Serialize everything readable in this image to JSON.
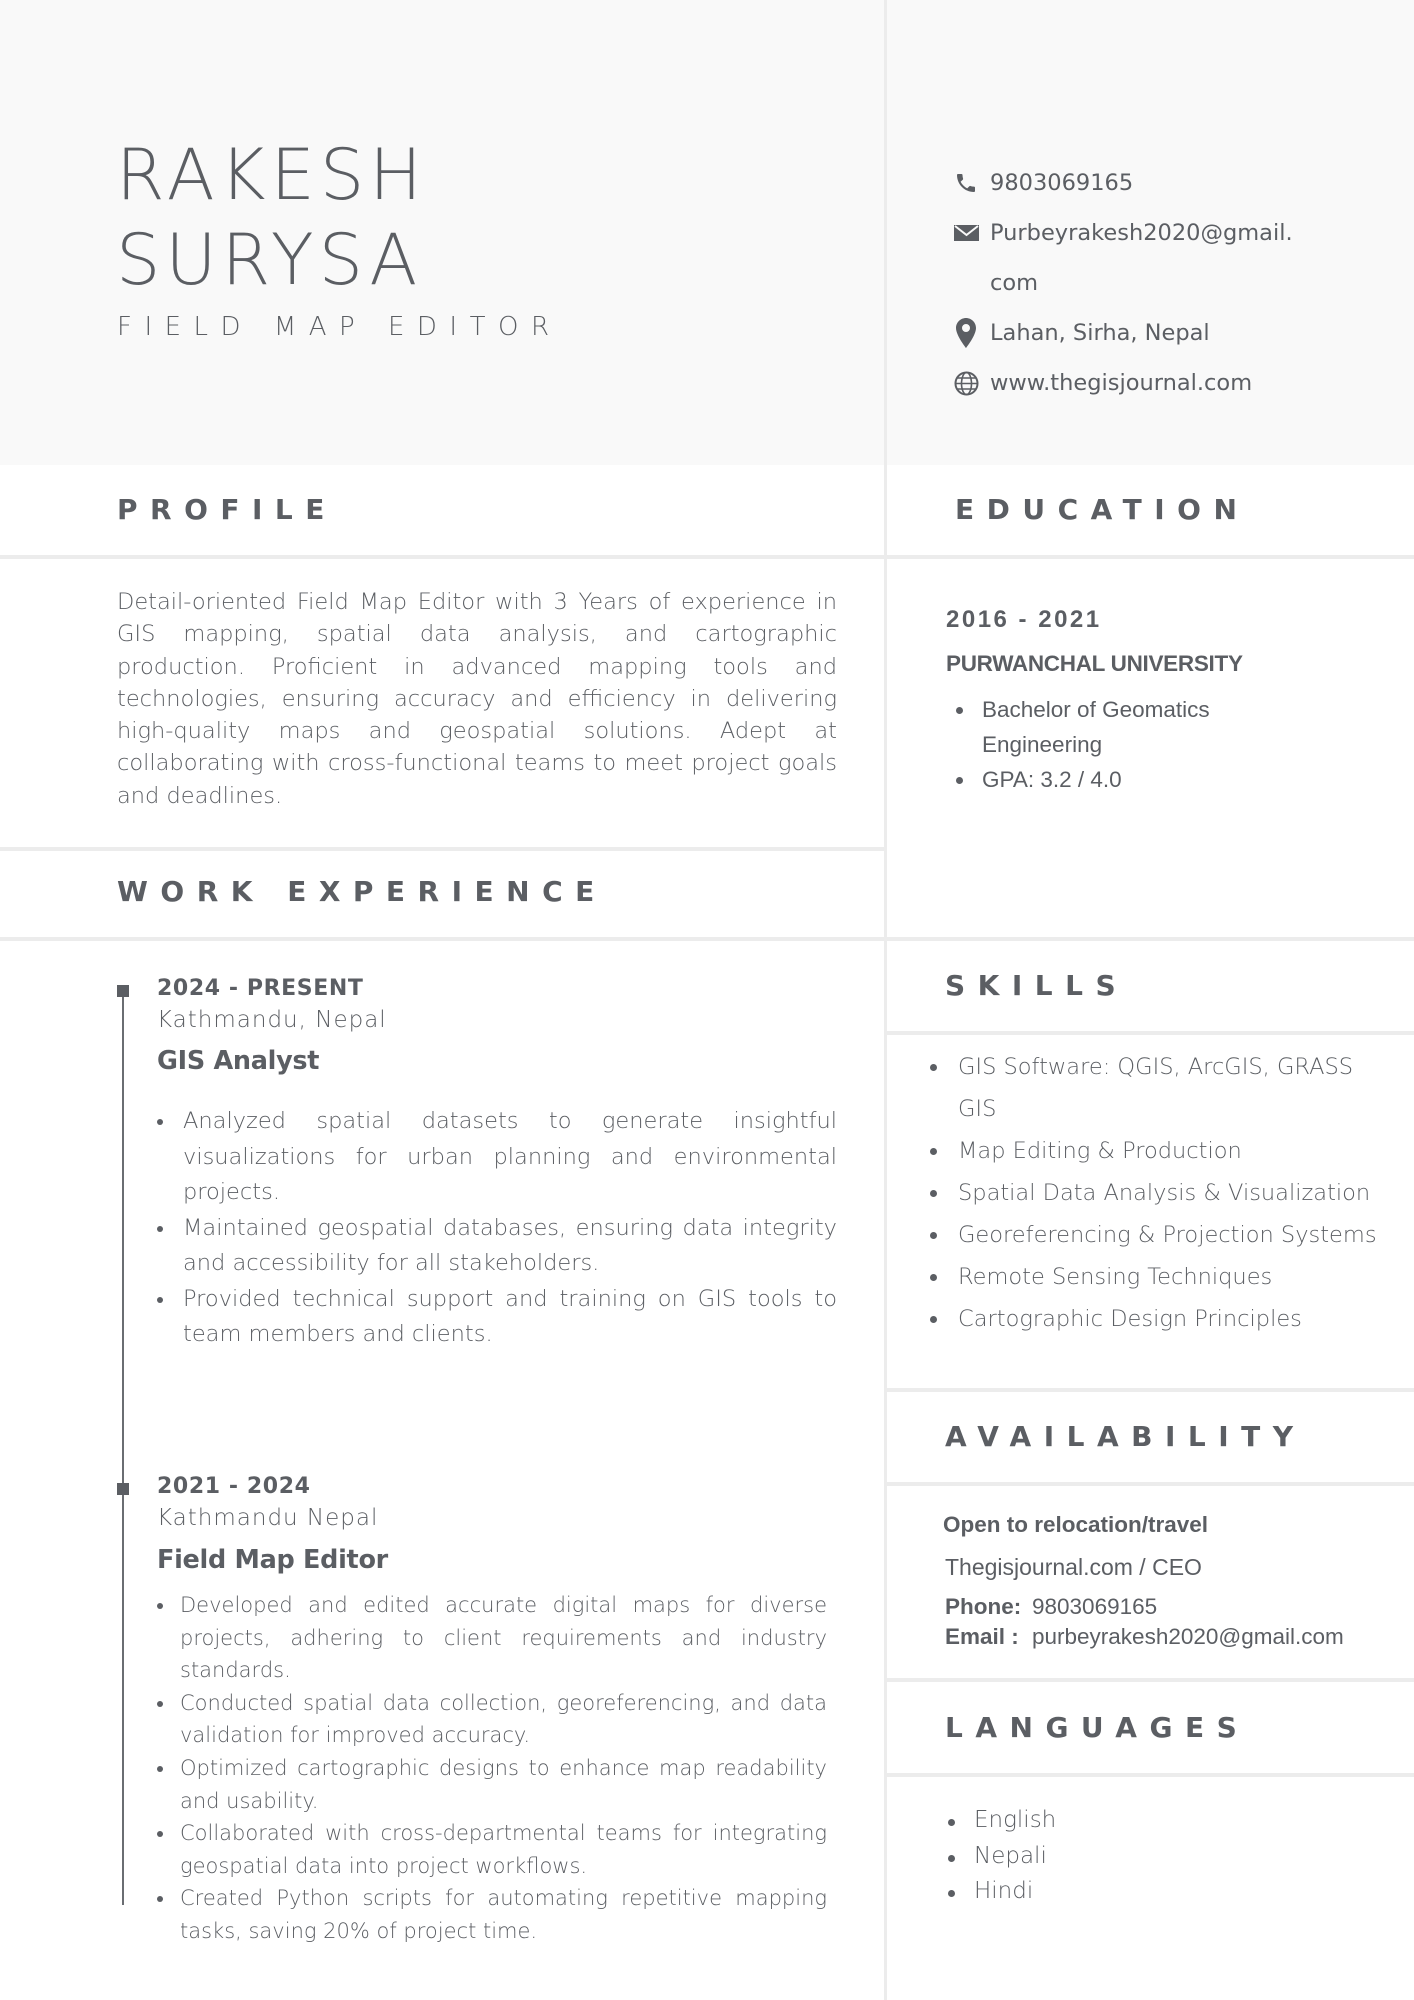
{
  "header": {
    "first_name": "RAKESH",
    "last_name": "SURYSA",
    "job_title": "FIELD MAP EDITOR"
  },
  "contact": {
    "phone": {
      "icon": "phone-icon",
      "text": "9803069165"
    },
    "email": {
      "icon": "email-icon",
      "line1": "Purbeyrakesh2020@gmail.",
      "line2": "com"
    },
    "location": {
      "icon": "location-pin-icon",
      "text": "Lahan, Sirha, Nepal"
    },
    "website": {
      "icon": "globe-icon",
      "text": "www.thegisjournal.com"
    }
  },
  "profile": {
    "title": "PROFILE",
    "text": "Detail-oriented Field Map Editor with 3 Years of experience in GIS mapping, spatial data analysis, and cartographic production. Proficient in advanced mapping tools and technologies, ensuring accuracy and efficiency in delivering high-quality maps and geospatial solutions. Adept at collaborating with cross-functional teams to meet project goals and deadlines."
  },
  "education": {
    "title": "EDUCATION",
    "years": "2016 - 2021",
    "school": "PURWANCHAL UNIVERSITY",
    "items": [
      "Bachelor of Geomatics Engineering",
      "GPA: 3.2 / 4.0"
    ]
  },
  "work": {
    "title": "WORK EXPERIENCE",
    "jobs": [
      {
        "date": "2024 - PRESENT",
        "location": "Kathmandu, Nepal",
        "role": "GIS Analyst",
        "bullets": [
          "Analyzed spatial datasets to generate insightful visualizations for urban planning and environmental projects.",
          "Maintained geospatial databases, ensuring data integrity and accessibility for all stakeholders.",
          "Provided technical support and training on GIS tools to team members and clients."
        ]
      },
      {
        "date": "2021 - 2024",
        "location": "Kathmandu Nepal",
        "role": "Field Map Editor",
        "bullets": [
          "Developed and edited accurate digital maps for diverse projects, adhering to client requirements and industry standards.",
          "Conducted spatial data collection, georeferencing, and data validation for improved accuracy.",
          "Optimized cartographic designs to enhance map readability and usability.",
          "Collaborated with cross-departmental teams for integrating geospatial data into project workflows.",
          "Created Python scripts for automating repetitive mapping tasks, saving 20% of project time."
        ]
      }
    ]
  },
  "skills": {
    "title": "SKILLS",
    "items": [
      "GIS Software: QGIS, ArcGIS, GRASS GIS",
      "Map Editing & Production",
      "Spatial Data Analysis & Visualization",
      "Georeferencing & Projection Systems",
      "Remote Sensing Techniques",
      "Cartographic Design Principles"
    ]
  },
  "availability": {
    "title": "AVAILABILITY",
    "headline": "Open to relocation/travel",
    "organization": "Thegisjournal.com / CEO",
    "phone_label": "Phone:",
    "phone_value": "9803069165",
    "email_label": "Email :",
    "email_value": "purbeyrakesh2020@gmail.com"
  },
  "languages": {
    "title": "LANGUAGES",
    "items": [
      "English",
      "Nepali",
      "Hindi"
    ]
  }
}
